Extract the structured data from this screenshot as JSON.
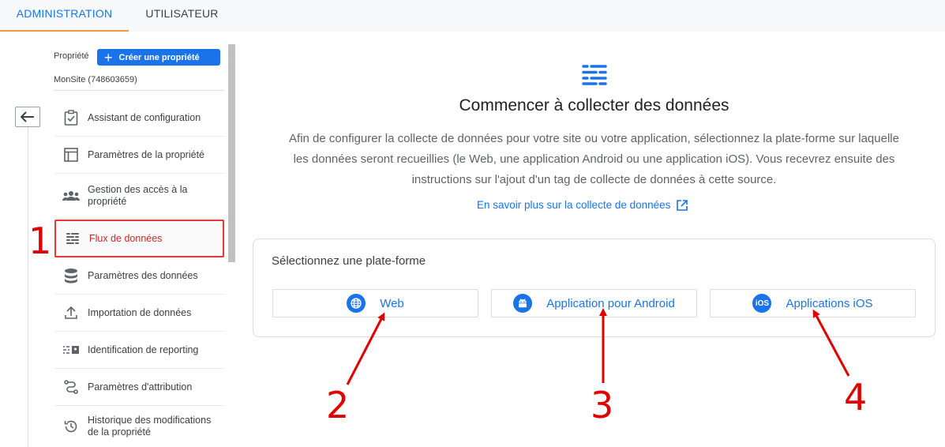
{
  "tabs": {
    "admin": "ADMINISTRATION",
    "user": "UTILISATEUR"
  },
  "sidebar": {
    "property_label": "Propriété",
    "create_button": "Créer une propriété",
    "site_name": "MonSite (748603659)",
    "items": [
      {
        "label": "Assistant de configuration",
        "icon": "checklist-icon"
      },
      {
        "label": "Paramètres de la propriété",
        "icon": "layout-icon"
      },
      {
        "label": "Gestion des accès à la propriété",
        "icon": "people-icon"
      },
      {
        "label": "Flux de données",
        "icon": "data-streams-icon"
      },
      {
        "label": "Paramètres des données",
        "icon": "database-icon"
      },
      {
        "label": "Importation de données",
        "icon": "upload-icon"
      },
      {
        "label": "Identification de reporting",
        "icon": "reporting-id-icon"
      },
      {
        "label": "Paramètres d'attribution",
        "icon": "attribution-icon"
      },
      {
        "label": "Historique des modifications de la propriété",
        "icon": "history-icon"
      }
    ]
  },
  "main": {
    "title": "Commencer à collecter des données",
    "description": "Afin de configurer la collecte de données pour votre site ou votre application, sélectionnez la plate-forme sur laquelle les données seront recueillies (le Web, une application Android ou une application iOS). Vous recevrez ensuite des instructions sur l'ajout d'un tag de collecte de données à cette source.",
    "learn_more": "En savoir plus sur la collecte de données",
    "platform_title": "Sélectionnez une plate-forme",
    "platforms": [
      {
        "label": "Web",
        "icon": "globe-icon"
      },
      {
        "label": "Application pour Android",
        "icon": "android-icon"
      },
      {
        "label": "Applications iOS",
        "icon": "ios-icon",
        "badge": "iOS"
      }
    ]
  },
  "annotations": {
    "m1": "1",
    "m2": "2",
    "m3": "3",
    "m4": "4"
  },
  "colors": {
    "accent": "#1a73e8",
    "annotation": "#e00000",
    "tab_underline": "#e8a13a"
  }
}
